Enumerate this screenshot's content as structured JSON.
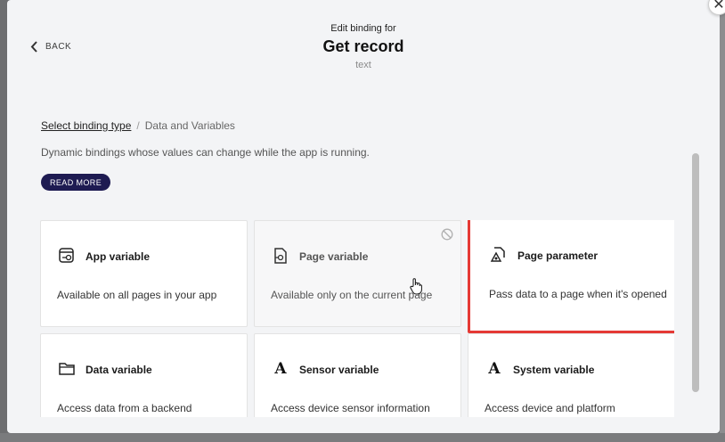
{
  "dialog": {
    "back_label": "BACK",
    "subtitle": "Edit binding for",
    "title": "Get record",
    "type_label": "text",
    "close_glyph": "✕"
  },
  "breadcrumb": {
    "link": "Select binding type",
    "separator": "/",
    "current": "Data and Variables"
  },
  "description": "Dynamic bindings whose values can change while the app is running.",
  "read_more_label": "READ MORE",
  "cards": [
    {
      "icon": "app-variable-icon",
      "title": "App variable",
      "description": "Available on all pages in your app",
      "disabled": false,
      "highlighted": false
    },
    {
      "icon": "page-variable-icon",
      "title": "Page variable",
      "description": "Available only on the current page",
      "disabled": true,
      "highlighted": false
    },
    {
      "icon": "page-parameter-icon",
      "title": "Page parameter",
      "description": "Pass data to a page when it's opened",
      "disabled": false,
      "highlighted": true
    },
    {
      "icon": "folder-icon",
      "title": "Data variable",
      "description": "Access data from a backend",
      "disabled": false,
      "highlighted": false
    },
    {
      "icon": "formula-a-icon",
      "title": "Sensor variable",
      "description": "Access device sensor information",
      "disabled": false,
      "highlighted": false
    },
    {
      "icon": "formula-a-icon",
      "title": "System variable",
      "description": "Access device and platform information",
      "disabled": false,
      "highlighted": false
    }
  ],
  "glyphs": {
    "formula_a": "A"
  },
  "colors": {
    "accent_dark": "#1e1b52",
    "highlight": "#e53935"
  }
}
